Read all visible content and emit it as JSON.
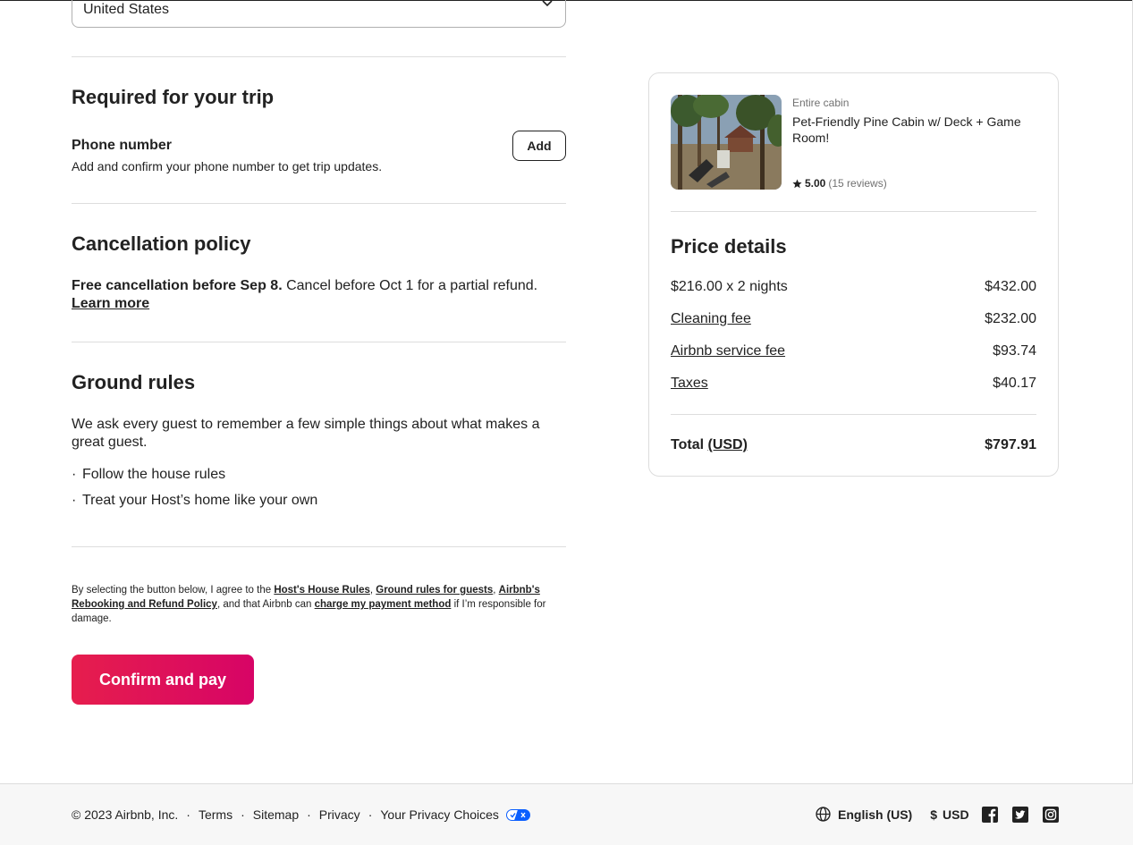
{
  "country_field": {
    "value": "United States"
  },
  "required": {
    "title": "Required for your trip",
    "phone_title": "Phone number",
    "phone_desc": "Add and confirm your phone number to get trip updates.",
    "add_label": "Add"
  },
  "cancellation": {
    "title": "Cancellation policy",
    "bold": "Free cancellation before Sep 8.",
    "text": " Cancel before Oct 1 for a partial refund.",
    "learn_more": "Learn more"
  },
  "ground_rules": {
    "title": "Ground rules",
    "intro": "We ask every guest to remember a few simple things about what makes a great guest.",
    "items": [
      "Follow the house rules",
      "Treat your Host’s home like your own"
    ]
  },
  "legal": {
    "pre": "By selecting the button below, I agree to the ",
    "link1": "Host's House Rules",
    "sep1": ", ",
    "link2": "Ground rules for guests",
    "sep2": ", ",
    "link3": "Airbnb's Rebooking and Refund Policy",
    "mid": ", and that Airbnb can ",
    "link4": "charge my payment method",
    "post": " if I’m responsible for damage."
  },
  "confirm_label": "Confirm and pay",
  "listing": {
    "type": "Entire cabin",
    "name": "Pet-Friendly Pine Cabin w/ Deck + Game Room!",
    "rating": "5.00",
    "reviews": "(15 reviews)"
  },
  "price": {
    "title": "Price details",
    "rows": [
      {
        "label": "$216.00 x 2 nights",
        "amount": "$432.00"
      },
      {
        "label": "Cleaning fee",
        "amount": "$232.00"
      },
      {
        "label": "Airbnb service fee",
        "amount": "$93.74"
      },
      {
        "label": "Taxes",
        "amount": "$40.17"
      }
    ],
    "total_label": "Total",
    "total_currency": "(USD)",
    "total_amount": "$797.91"
  },
  "footer": {
    "copyright": "© 2023 Airbnb, Inc.",
    "links": [
      "Terms",
      "Sitemap",
      "Privacy",
      "Your Privacy Choices"
    ],
    "separator": "·",
    "language": "English (US)",
    "currency_symbol": "$",
    "currency": "USD"
  },
  "colors": {
    "brand_start": "#e61e4d",
    "brand_end": "#d70466",
    "text": "#222222",
    "muted": "#717171"
  }
}
